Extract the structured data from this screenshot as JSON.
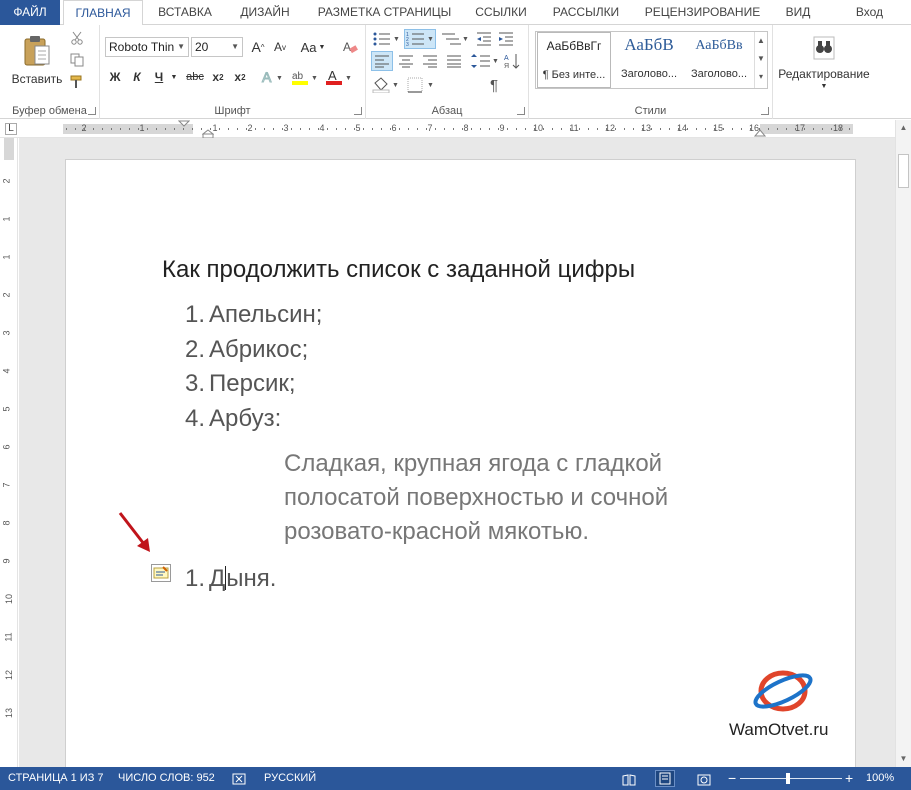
{
  "tabs": {
    "file": "ФАЙЛ",
    "home": "ГЛАВНАЯ",
    "insert": "ВСТАВКА",
    "design": "ДИЗАЙН",
    "layout": "РАЗМЕТКА СТРАНИЦЫ",
    "references": "ССЫЛКИ",
    "mailings": "РАССЫЛКИ",
    "review": "РЕЦЕНЗИРОВАНИЕ",
    "view": "ВИД",
    "login": "Вход"
  },
  "ribbon": {
    "clipboard": {
      "paste_label": "Вставить",
      "group_label": "Буфер обмена"
    },
    "font": {
      "font_name": "Roboto Thin",
      "font_size": "20",
      "grow": "A",
      "shrink": "A",
      "case": "Aa",
      "bold": "Ж",
      "italic": "К",
      "underline": "Ч",
      "strike": "abc",
      "subscript": "x",
      "superscript": "x",
      "group_label": "Шрифт"
    },
    "paragraph": {
      "group_label": "Абзац"
    },
    "styles": {
      "items": [
        {
          "sample": "АаБбВвГг",
          "name": "¶ Без инте..."
        },
        {
          "sample": "АаБбВ",
          "name": "Заголово..."
        },
        {
          "sample": "АаБбВв",
          "name": "Заголово..."
        }
      ],
      "group_label": "Стили"
    },
    "editing": {
      "label": "Редактирование"
    }
  },
  "ruler": {
    "h_numbers": [
      "2",
      "1",
      "1",
      "2",
      "3",
      "4",
      "5",
      "6",
      "7",
      "8",
      "9",
      "10",
      "11",
      "12",
      "13",
      "14",
      "15",
      "16",
      "17",
      "18"
    ],
    "v_numbers": [
      "2",
      "1",
      "1",
      "2",
      "3",
      "4",
      "5",
      "6",
      "7",
      "8",
      "9",
      "10",
      "11",
      "12",
      "13"
    ]
  },
  "document": {
    "title": "Как продолжить список с заданной цифры",
    "list": [
      {
        "num": "1.",
        "text": "Апельсин;"
      },
      {
        "num": "2.",
        "text": "Абрикос;"
      },
      {
        "num": "3.",
        "text": "Персик;"
      },
      {
        "num": "4.",
        "text": "Арбуз:"
      }
    ],
    "paragraph": "Сладкая, крупная ягода с гладкой полосатой поверхностью и сочной розовато-красной мякотью.",
    "restart_item": {
      "num": "1.",
      "text_before": "Д",
      "text_after": "ыня."
    },
    "watermark": "WamOtvet.ru"
  },
  "status": {
    "page": "СТРАНИЦА 1 ИЗ 7",
    "words": "ЧИСЛО СЛОВ: 952",
    "language": "РУССКИЙ",
    "zoom": "100%",
    "zoom_minus": "−",
    "zoom_plus": "+"
  }
}
